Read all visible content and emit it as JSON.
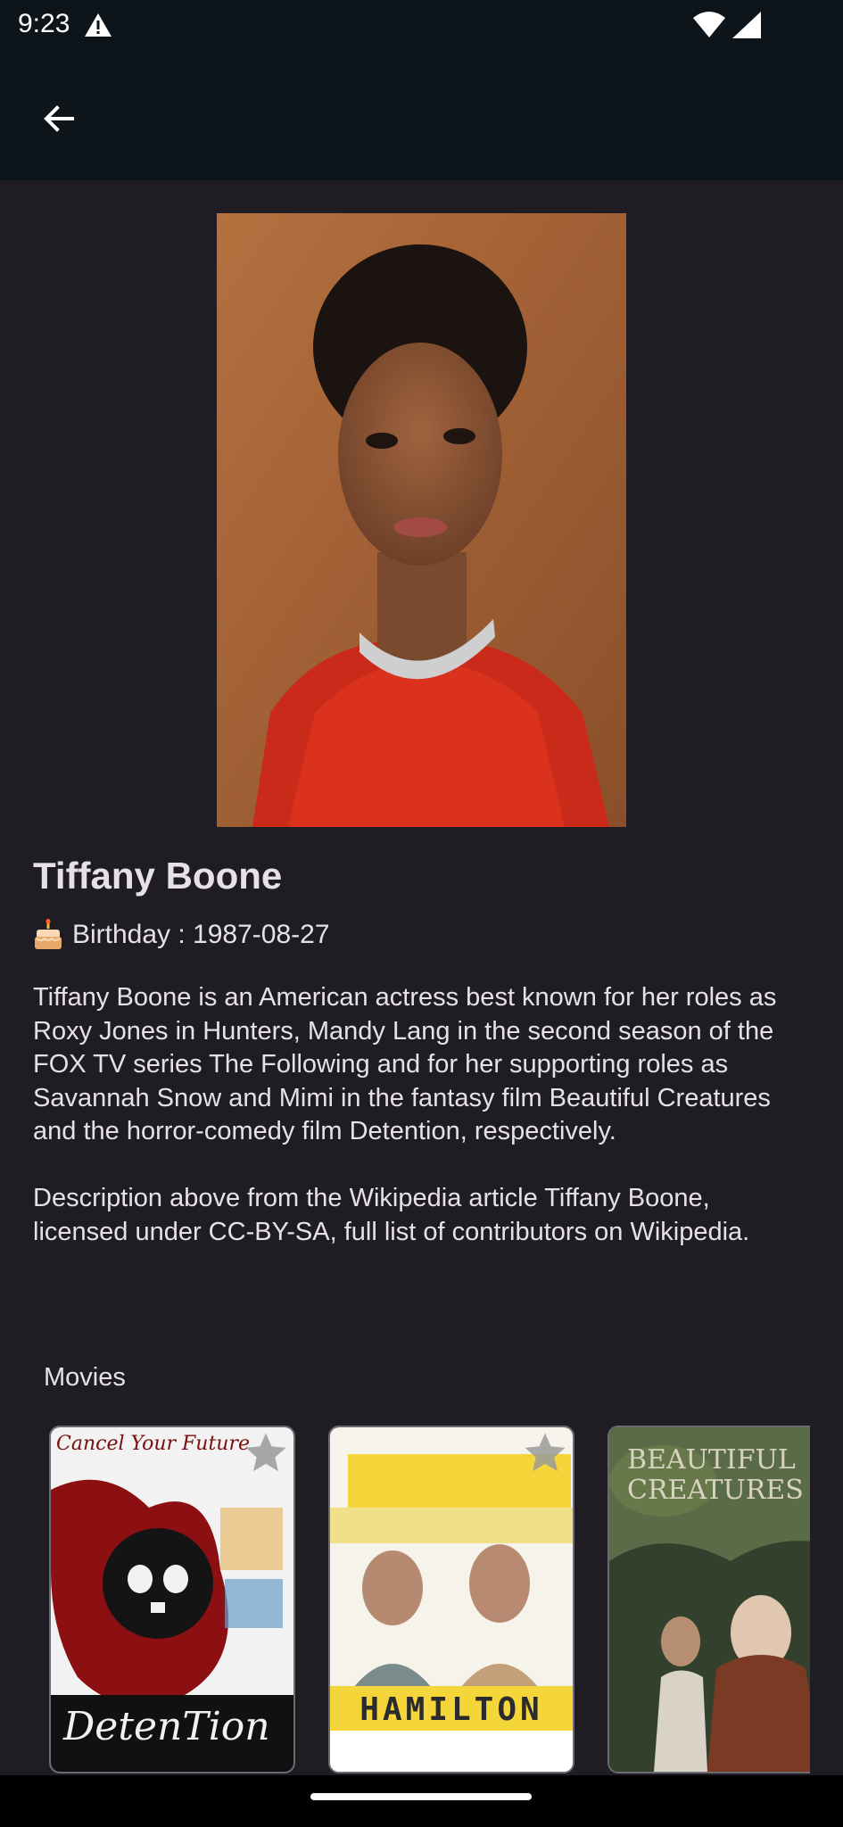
{
  "status_bar": {
    "time": "9:23",
    "icons": [
      "warning-icon",
      "wifi-icon",
      "signal-icon"
    ]
  },
  "app_bar": {
    "back_icon": "arrow-left-icon"
  },
  "person": {
    "name": "Tiffany Boone",
    "birthday_icon": "cake-icon",
    "birthday": "Birthday : 1987-08-27",
    "bio": "Tiffany Boone is an American actress best known for her roles as Roxy Jones in Hunters, Mandy Lang in the second season of the FOX TV series The Following and for her supporting roles as Savannah Snow and Mimi in the fantasy film Beautiful Creatures and the horror-comedy film Detention, respectively.\n\nDescription above from the Wikipedia article Tiffany Boone, licensed under CC-BY-SA, full list of contributors on Wikipedia."
  },
  "movies": {
    "title": "Movies",
    "items": [
      {
        "poster_title": "DetenTion",
        "poster_tagline": "Cancel Your Future",
        "favorite_icon": "star-icon"
      },
      {
        "poster_title": "HAMILTON",
        "favorite_icon": "star-icon"
      },
      {
        "poster_title": "BEAUTIFUL CREATURES"
      }
    ]
  },
  "colors": {
    "background": "#1f1d23",
    "app_bar": "#0d151b",
    "text": "#e6e1e9",
    "card_border": "#6c6a72"
  }
}
